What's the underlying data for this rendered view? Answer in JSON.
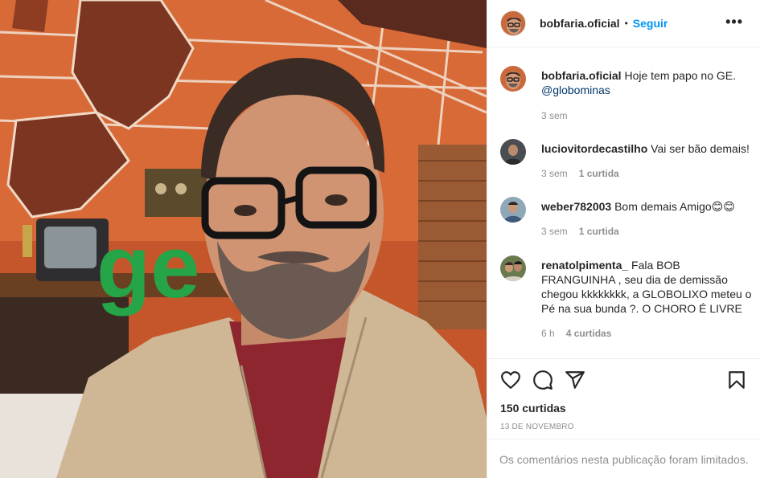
{
  "post": {
    "username": "bobfaria.oficial",
    "separator": "•",
    "follow_label": "Seguir",
    "more_icon": "more-options-icon",
    "more_label": "•••"
  },
  "caption": {
    "username": "bobfaria.oficial",
    "text": " Hoje tem papo no GE.",
    "mention": "@globominas",
    "time": "3 sem"
  },
  "comments": [
    {
      "username": "luciovitordecastilho",
      "text": " Vai ser bão demais!",
      "time": "3 sem",
      "likes": "1 curtida"
    },
    {
      "username": "weber782003",
      "text": " Bom demais Amigo😊😊",
      "time": "3 sem",
      "likes": "1 curtida"
    },
    {
      "username": "renatolpimenta_",
      "text": " Fala BOB FRANGUINHA , seu dia de demissão chegou kkkkkkkk, a GLOBOLIXO meteu o Pé na sua bunda ?. O CHORO É LIVRE",
      "time": "6 h",
      "likes": "4 curtidas"
    }
  ],
  "actions": {
    "like_icon": "heart-icon",
    "comment_icon": "comment-icon",
    "share_icon": "share-icon",
    "save_icon": "bookmark-icon"
  },
  "stats": {
    "likes": "150 curtidas",
    "date": "13 de novembro"
  },
  "footer": {
    "limited_text": "Os comentários nesta publicação foram limitados."
  },
  "photo": {
    "sign_text": "ge"
  }
}
